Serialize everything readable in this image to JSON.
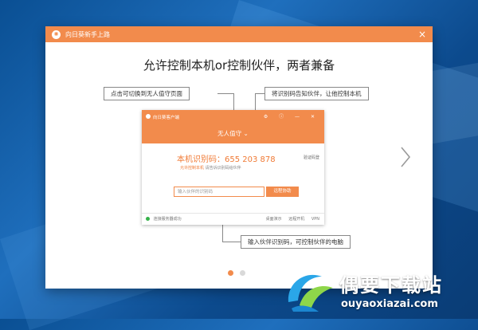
{
  "window": {
    "title": "向日葵新手上路",
    "close_glyph": "×"
  },
  "main": {
    "heading": "允许控制本机or控制伙伴，两者兼备",
    "callouts": {
      "switch_mode": "点击可切换到无人值守页面",
      "tell_partner": "将识别码告知伙伴，让他控制本机",
      "enter_partner": "输入伙伴识别码，可控制伙伴的电脑"
    },
    "pager": {
      "count": 2,
      "active_index": 0
    }
  },
  "app_preview": {
    "title": "向日葵客户端",
    "controls": "⚙ ⓘ — ✕",
    "mode": "无人值守 ⌄",
    "id_label": "本机识别码：655 203 878",
    "id_note": "验证码登",
    "allow_control": "允许控制本机",
    "allow_hint": "请告诉识别码给伙伴",
    "partner_placeholder": "输入伙伴的识别码",
    "remote_button": "远程协助",
    "status": "连接服务器成功",
    "footer_items": [
      "桌面演示",
      "远程开机",
      "VPN"
    ]
  },
  "watermark": {
    "brand": "偶要下载站",
    "url": "ouyaoxiazai.com"
  },
  "colors": {
    "accent": "#f28b4c",
    "online": "#36b24a"
  }
}
